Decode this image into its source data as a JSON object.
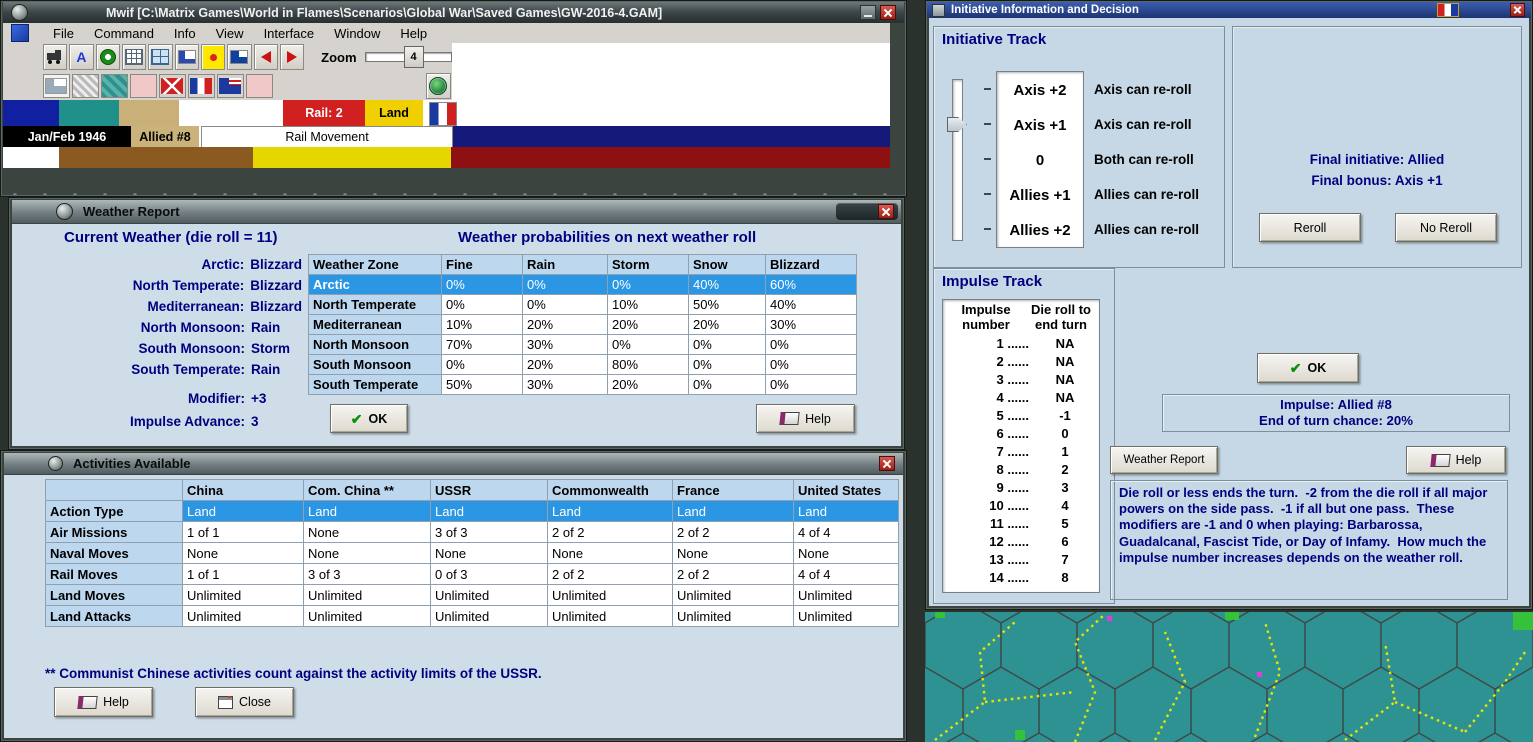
{
  "icons": {
    "check": "✔",
    "font_a": "A"
  },
  "main_window": {
    "title": "Mwif [C:\\Matrix Games\\World in Flames\\Scenarios\\Global War\\Saved Games\\GW-2016-4.GAM]",
    "menu_items": [
      "File",
      "Command",
      "Info",
      "View",
      "Interface",
      "Window",
      "Help"
    ],
    "toolbar": {
      "zoom_label": "Zoom",
      "zoom_value": "4"
    },
    "status": {
      "rail": "Rail: 2",
      "land": "Land",
      "date": "Jan/Feb 1946",
      "impulse": "Allied #8",
      "mode": "Rail Movement"
    }
  },
  "weather_window": {
    "title": "Weather Report",
    "current_heading": "Current Weather (die roll = 11)",
    "current_rows": [
      {
        "label": "Arctic:",
        "value": "Blizzard"
      },
      {
        "label": "North Temperate:",
        "value": "Blizzard"
      },
      {
        "label": "Mediterranean:",
        "value": "Blizzard"
      },
      {
        "label": "North Monsoon:",
        "value": "Rain"
      },
      {
        "label": "South Monsoon:",
        "value": "Storm"
      },
      {
        "label": "South Temperate:",
        "value": "Rain"
      }
    ],
    "modifier_label": "Modifier:",
    "modifier_value": "+3",
    "impulse_advance_label": "Impulse Advance:",
    "impulse_advance_value": "3",
    "prob_heading": "Weather probabilities on next weather roll",
    "table": {
      "headers": [
        "Weather Zone",
        "Fine",
        "Rain",
        "Storm",
        "Snow",
        "Blizzard"
      ],
      "rows": [
        {
          "zone": "Arctic",
          "values": [
            "0%",
            "0%",
            "0%",
            "40%",
            "60%"
          ]
        },
        {
          "zone": "North Temperate",
          "values": [
            "0%",
            "0%",
            "10%",
            "50%",
            "40%"
          ]
        },
        {
          "zone": "Mediterranean",
          "values": [
            "10%",
            "20%",
            "20%",
            "20%",
            "30%"
          ]
        },
        {
          "zone": "North Monsoon",
          "values": [
            "70%",
            "30%",
            "0%",
            "0%",
            "0%"
          ]
        },
        {
          "zone": "South Monsoon",
          "values": [
            "0%",
            "20%",
            "80%",
            "0%",
            "0%"
          ]
        },
        {
          "zone": "South Temperate",
          "values": [
            "50%",
            "30%",
            "20%",
            "0%",
            "0%"
          ]
        }
      ]
    },
    "ok_label": "OK",
    "help_label": "Help"
  },
  "activities_window": {
    "title": "Activities Available",
    "table": {
      "headers": [
        "China",
        "Com. China **",
        "USSR",
        "Commonwealth",
        "France",
        "United States"
      ],
      "rows": [
        {
          "label": "Action Type",
          "values": [
            "Land",
            "Land",
            "Land",
            "Land",
            "Land",
            "Land"
          ]
        },
        {
          "label": "Air Missions",
          "values": [
            "1 of 1",
            "None",
            "3 of 3",
            "2 of 2",
            "2 of 2",
            "4 of 4"
          ]
        },
        {
          "label": "Naval Moves",
          "values": [
            "None",
            "None",
            "None",
            "None",
            "None",
            "None"
          ]
        },
        {
          "label": "Rail Moves",
          "values": [
            "1 of 1",
            "3 of 3",
            "0 of 3",
            "2 of 2",
            "2 of 2",
            "4 of 4"
          ]
        },
        {
          "label": "Land Moves",
          "values": [
            "Unlimited",
            "Unlimited",
            "Unlimited",
            "Unlimited",
            "Unlimited",
            "Unlimited"
          ]
        },
        {
          "label": "Land Attacks",
          "values": [
            "Unlimited",
            "Unlimited",
            "Unlimited",
            "Unlimited",
            "Unlimited",
            "Unlimited"
          ]
        }
      ]
    },
    "note": "** Communist Chinese activities count against the activity limits of the USSR.",
    "help_label": "Help",
    "close_label": "Close"
  },
  "initiative_window": {
    "title": "Initiative Information and Decision",
    "initiative_track": {
      "heading": "Initiative Track",
      "items": [
        {
          "value": "Axis +2",
          "desc": "Axis can re-roll"
        },
        {
          "value": "Axis +1",
          "desc": "Axis can re-roll"
        },
        {
          "value": "0",
          "desc": "Both can re-roll"
        },
        {
          "value": "Allies +1",
          "desc": "Allies can re-roll"
        },
        {
          "value": "Allies +2",
          "desc": "Allies can re-roll"
        }
      ]
    },
    "decision": {
      "final_initiative": "Final initiative: Allied",
      "final_bonus": "Final bonus: Axis +1",
      "reroll_label": "Reroll",
      "no_reroll_label": "No Reroll"
    },
    "impulse_track": {
      "heading": "Impulse Track",
      "col1_line1": "Impulse",
      "col1_line2": "number",
      "col2_line1": "Die roll to",
      "col2_line2": "end turn",
      "rows": [
        {
          "num": "1 ......",
          "val": "NA"
        },
        {
          "num": "2 ......",
          "val": "NA"
        },
        {
          "num": "3 ......",
          "val": "NA"
        },
        {
          "num": "4 ......",
          "val": "NA"
        },
        {
          "num": "5 ......",
          "val": "-1"
        },
        {
          "num": "6 ......",
          "val": "0"
        },
        {
          "num": "7 ......",
          "val": "1"
        },
        {
          "num": "8 ......",
          "val": "2"
        },
        {
          "num": "9 ......",
          "val": "3"
        },
        {
          "num": "10 ......",
          "val": "4"
        },
        {
          "num": "11 ......",
          "val": "5"
        },
        {
          "num": "12 ......",
          "val": "6"
        },
        {
          "num": "13 ......",
          "val": "7"
        },
        {
          "num": "14 ......",
          "val": "8"
        }
      ]
    },
    "ok_label": "OK",
    "impulse_status_line1": "Impulse: Allied #8",
    "impulse_status_line2": "End of turn chance: 20%",
    "weather_report_label": "Weather Report",
    "help_label": "Help",
    "explanation": "Die roll or less ends the turn.  -2 from the die roll if all major powers on the side pass.  -1 if all but one pass.  These modifiers are -1 and 0 when playing: Barbarossa, Guadalcanal, Fascist Tide, or Day of Infamy.  How much the impulse number increases depends on the weather roll."
  }
}
